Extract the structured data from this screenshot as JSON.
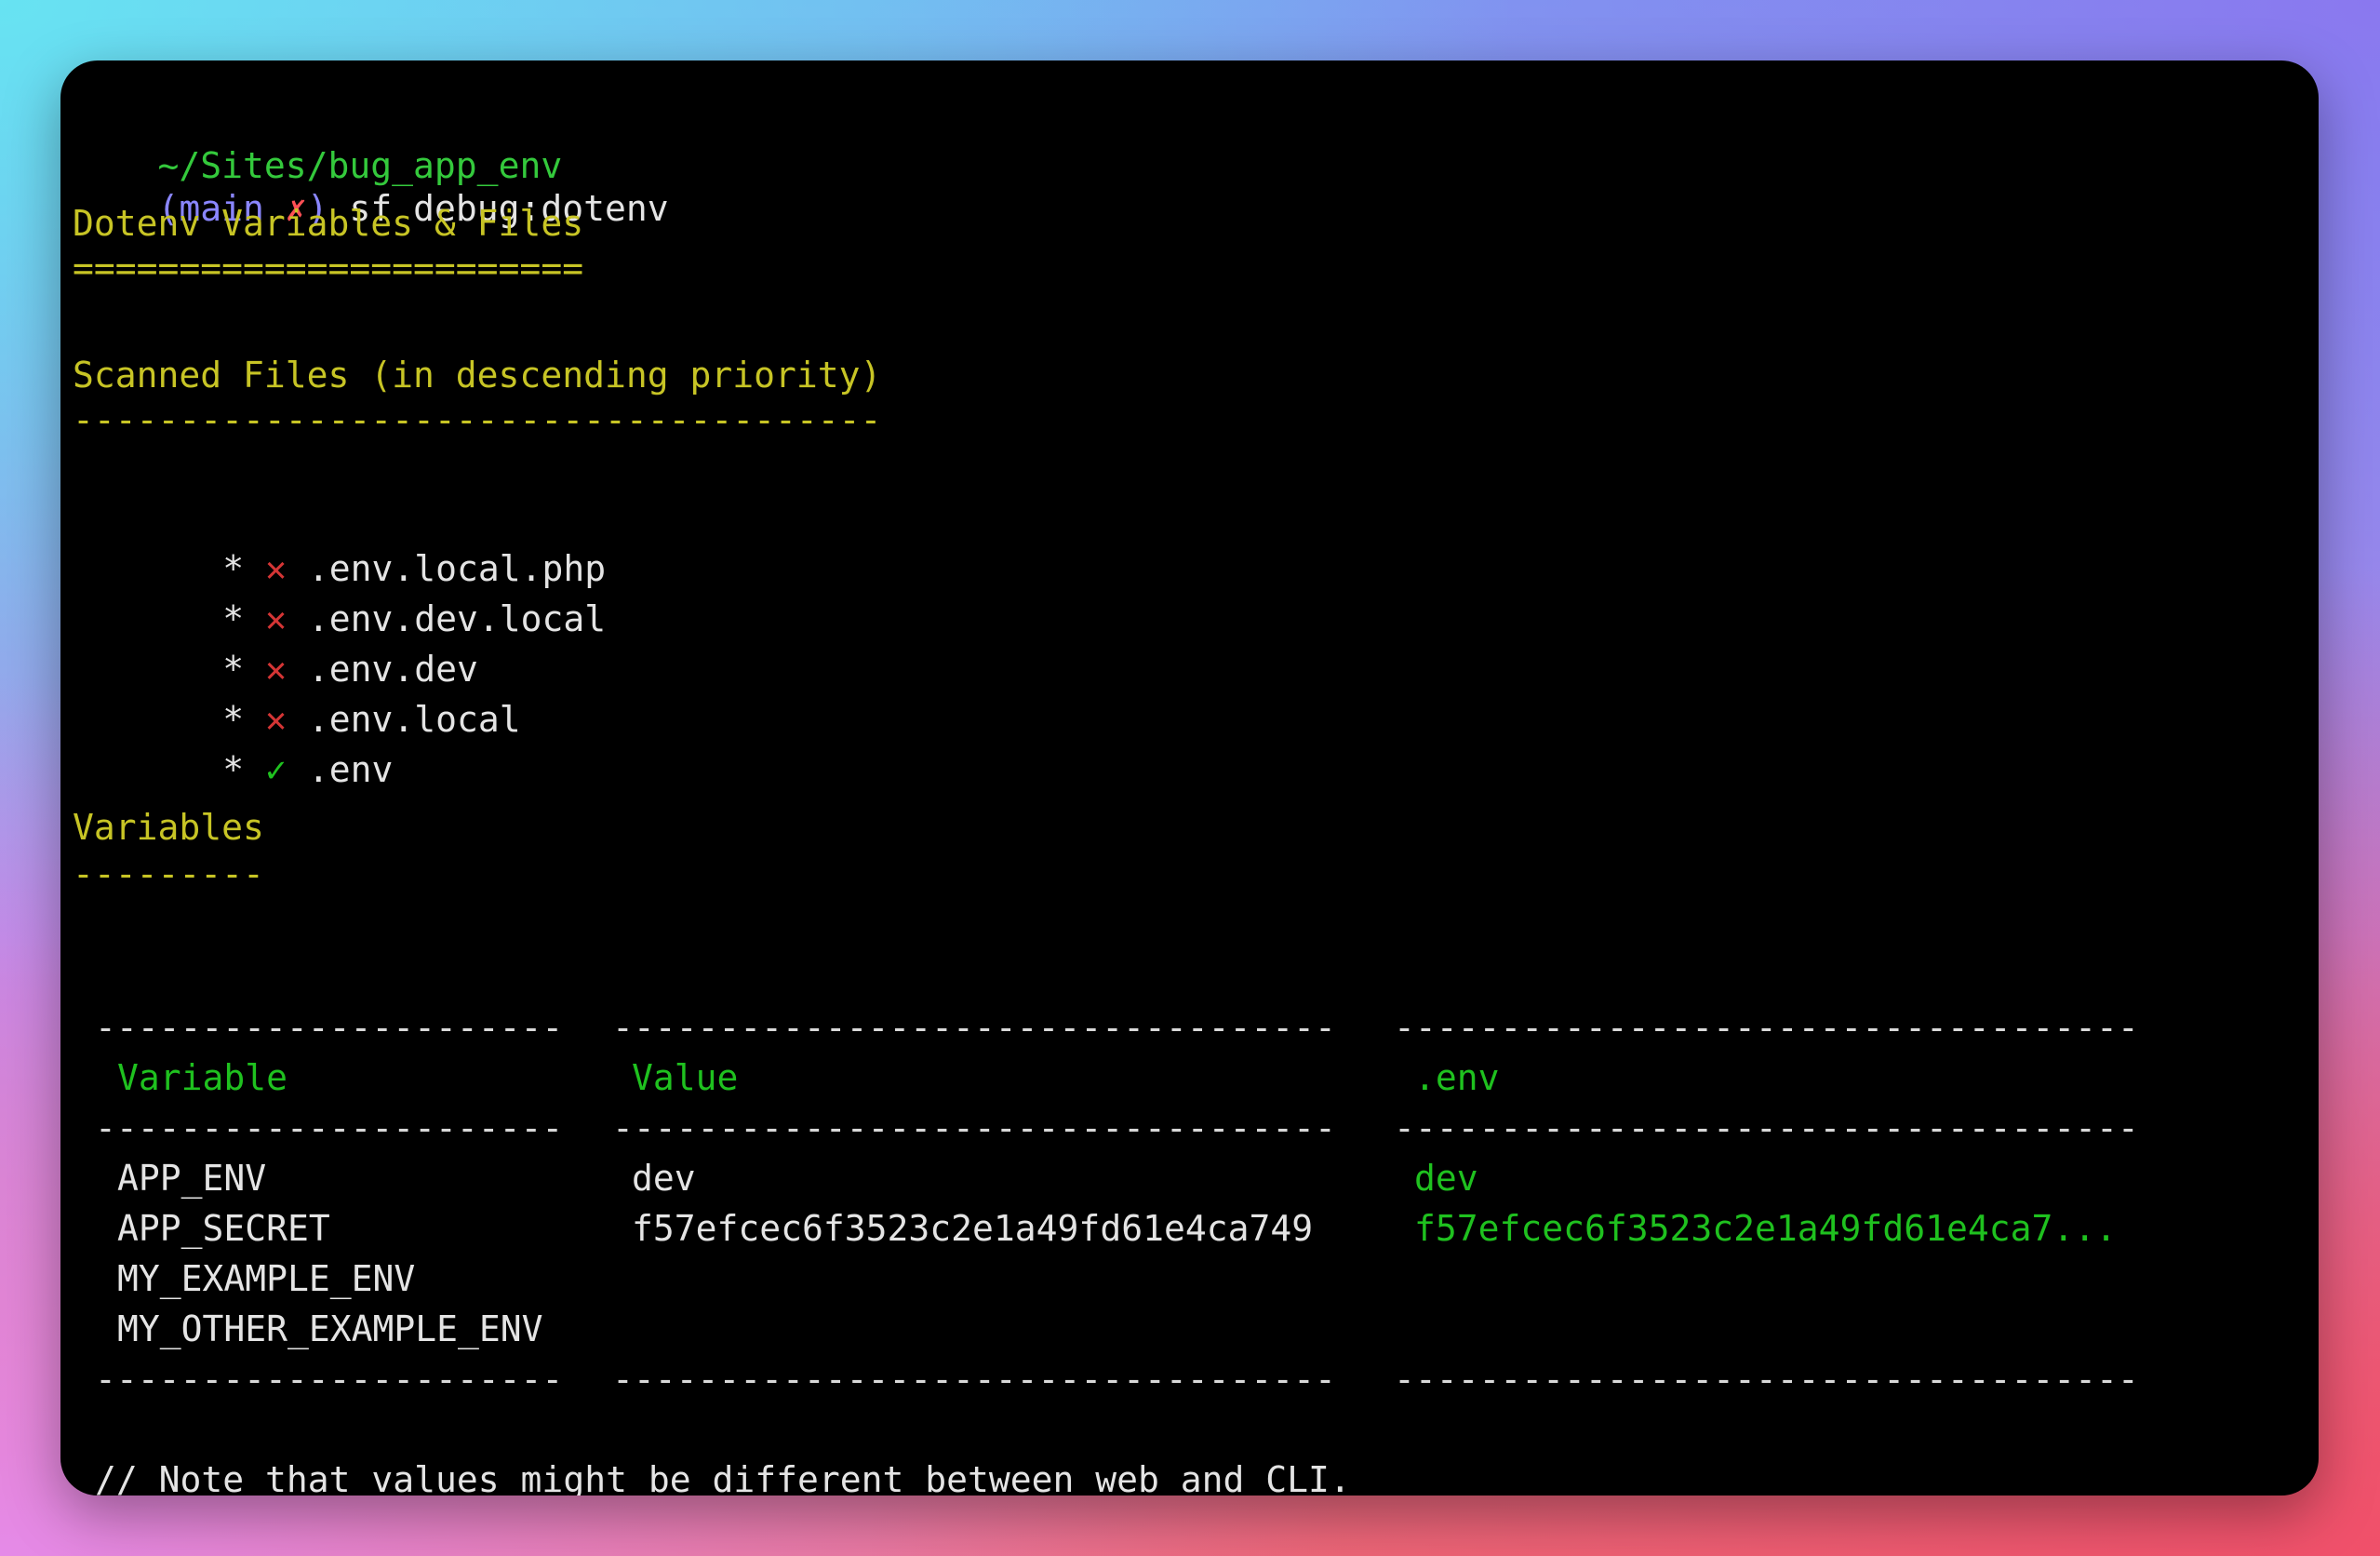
{
  "prompt": {
    "path": "~/Sites/bug_app_env",
    "branch_open": "(main ",
    "dirty_mark": "✗",
    "branch_close": ")",
    "command": " sf debug:dotenv"
  },
  "title": {
    "text": "Dotenv Variables & Files",
    "underline": "========================"
  },
  "scanned": {
    "heading": "Scanned Files (in descending priority)",
    "underline": "--------------------------------------",
    "files": [
      {
        "bullet": "*",
        "mark": "✕",
        "name": ".env.local.php",
        "found": false
      },
      {
        "bullet": "*",
        "mark": "✕",
        "name": ".env.dev.local",
        "found": false
      },
      {
        "bullet": "*",
        "mark": "✕",
        "name": ".env.dev",
        "found": false
      },
      {
        "bullet": "*",
        "mark": "✕",
        "name": ".env.local",
        "found": false
      },
      {
        "bullet": "*",
        "mark": "✓",
        "name": ".env",
        "found": true
      }
    ]
  },
  "variables": {
    "heading": "Variables",
    "underline": "---------",
    "rule": {
      "col1": "----------------------",
      "col2": "----------------------------------",
      "col3": "-----------------------------------"
    },
    "headers": [
      "Variable",
      "Value",
      ".env"
    ],
    "rows": [
      [
        "APP_ENV",
        "dev",
        "dev"
      ],
      [
        "APP_SECRET",
        "f57efcec6f3523c2e1a49fd61e4ca749",
        "f57efcec6f3523c2e1a49fd61e4ca7..."
      ],
      [
        "MY_EXAMPLE_ENV",
        "",
        ""
      ],
      [
        "MY_OTHER_EXAMPLE_ENV",
        "",
        ""
      ]
    ]
  },
  "note": "// Note that values might be different between web and CLI.",
  "colors": {
    "background": "#000000",
    "yellow": "#c7c425",
    "green": "#1fc11f",
    "path_green": "#34c93c",
    "branch_purple": "#8a86ff",
    "red": "#d43535",
    "text": "#e4e4e4"
  }
}
